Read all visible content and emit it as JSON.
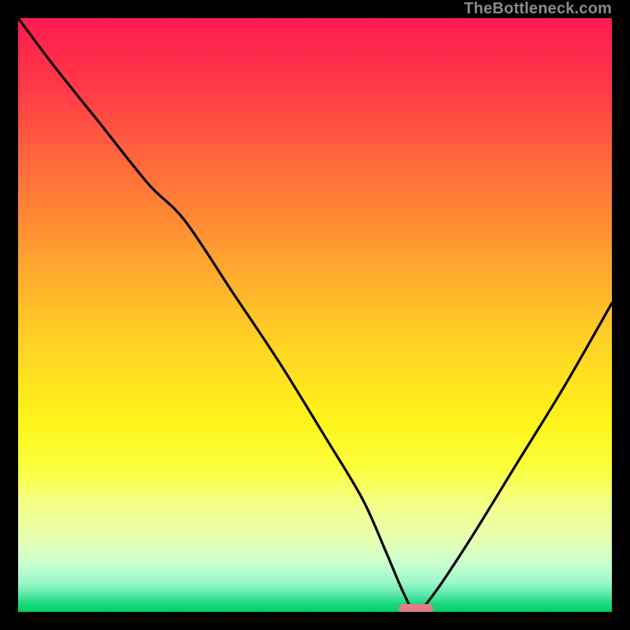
{
  "watermark": "TheBottleneck.com",
  "chart_data": {
    "type": "line",
    "title": "",
    "xlabel": "",
    "ylabel": "",
    "xlim": [
      0,
      100
    ],
    "ylim": [
      0,
      100
    ],
    "grid": false,
    "legend": false,
    "background_gradient": {
      "top_color": "#ff1a50",
      "bottom_color": "#02cf5e",
      "description": "vertical gradient red→orange→yellow→green"
    },
    "marker": {
      "x": 67,
      "y": 0.5,
      "shape": "pill",
      "color": "#e27c89",
      "note": "optimal point marker at curve minimum"
    },
    "series": [
      {
        "name": "bottleneck-curve",
        "color": "#000000",
        "x": [
          0,
          6,
          14,
          22,
          28,
          36,
          44,
          52,
          58,
          62,
          65,
          67,
          70,
          76,
          84,
          92,
          100
        ],
        "y": [
          100,
          92,
          82,
          72,
          66,
          54,
          42,
          29,
          19,
          10,
          3,
          0,
          3,
          12,
          25,
          38,
          52
        ]
      }
    ]
  }
}
